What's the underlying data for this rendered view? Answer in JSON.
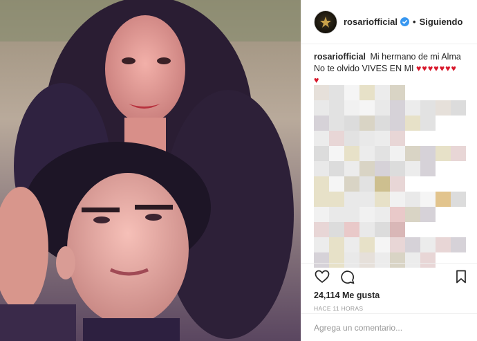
{
  "post": {
    "username": "rosariofficial",
    "verified_badge": "verified-check-icon",
    "separator": "•",
    "follow_status": "Siguiendo",
    "caption_user": "rosariofficial",
    "caption_text": "Mi hermano de mi Alma No te olvido VIVES EN MI",
    "caption_hearts": "♥♥♥♥♥♥♥ ♥",
    "likes": "24,114 Me gusta",
    "timestamp": "HACE 11 HORAS",
    "comment_placeholder": "Agrega un comentario..."
  },
  "icons": {
    "like": "heart-outline-icon",
    "comment": "speech-bubble-icon",
    "save": "bookmark-icon"
  },
  "colors": {
    "accent_blue": "#3897f0",
    "heart_red": "#d8182b",
    "text_primary": "#262626",
    "text_muted": "#999999",
    "divider": "#efefef"
  }
}
